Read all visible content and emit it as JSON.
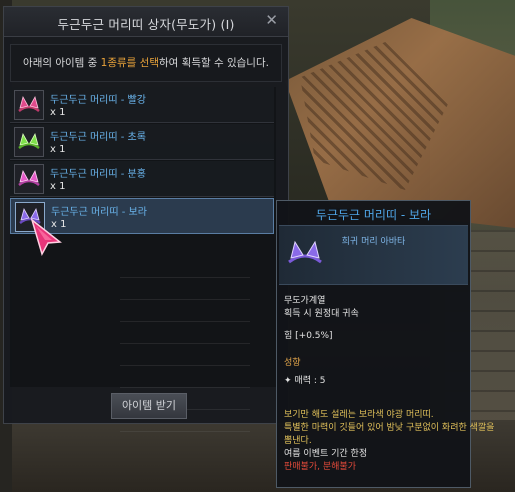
{
  "dialog": {
    "title": "두근두근 머리띠 상자(무도가) (I)",
    "instruction_prefix": "아래의 아이템 중 ",
    "instruction_highlight": "1종류를 선택",
    "instruction_suffix": "하여 획득할 수 있습니다.",
    "items": [
      {
        "name": "두근두근 머리띠 - 빨강",
        "qty": "x 1",
        "color": "#e04a8c"
      },
      {
        "name": "두근두근 머리띠 - 초록",
        "qty": "x 1",
        "color": "#7ee04a"
      },
      {
        "name": "두근두근 머리띠 - 분홍",
        "qty": "x 1",
        "color": "#e45ac8"
      },
      {
        "name": "두근두근 머리띠 - 보라",
        "qty": "x 1",
        "color": "#8a6ae8"
      }
    ],
    "receive_label": "아이템 받기"
  },
  "tooltip": {
    "title": "두근두근 머리띠 - 보라",
    "grade": "희귀 머리 아바타",
    "class_line": "무도가계열",
    "bind_line": "획득 시 원정대 귀속",
    "stat_line": "힘 [+0.5%]",
    "trait_header": "성향",
    "trait_value": "매력 : 5",
    "desc1": "보기만 해도 설레는 보라색 야광 머리띠.",
    "desc2": "특별한 마력이 깃들어 있어 밤낮 구분없이 화려한 색깔을",
    "desc3": "뽐낸다.",
    "event_line": "여름 이벤트 기간 한정",
    "restrict_1": "판매불가",
    "restrict_sep": ", ",
    "restrict_2": "분해불가"
  },
  "colors": {
    "accent_blue": "#4fa6e8",
    "highlight_orange": "#e8a23a",
    "restriction_red": "#e24a3a"
  }
}
